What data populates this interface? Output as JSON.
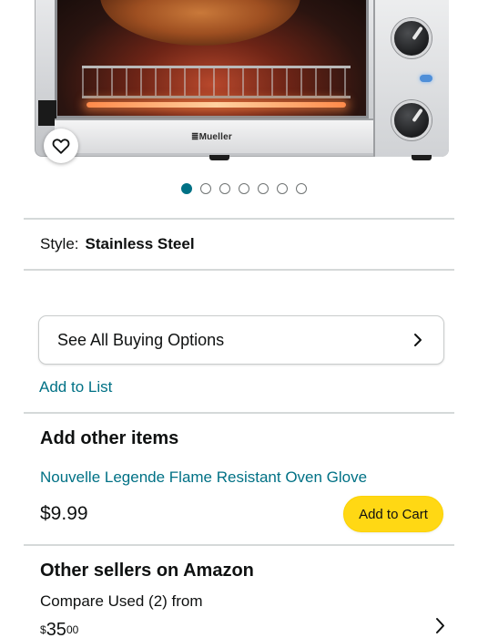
{
  "product_image": {
    "brand_logo": "≣Mueller",
    "wishlist_icon": "heart-outline-icon"
  },
  "carousel": {
    "total_images": 7,
    "active_index": 0,
    "active_color": "#007185"
  },
  "style": {
    "label": "Style:",
    "value": "Stainless Steel"
  },
  "buying_options": {
    "label": "See All Buying Options",
    "icon": "chevron-right-icon"
  },
  "add_to_list": {
    "label": "Add to List"
  },
  "add_other_items": {
    "title": "Add other items",
    "item_name": "Nouvelle Legende Flame Resistant Oven Glove",
    "item_price": "$9.99",
    "add_to_cart_label": "Add to Cart",
    "add_to_cart_color": "#ffd814"
  },
  "other_sellers": {
    "title": "Other sellers on Amazon",
    "compare_text": "Compare Used (2) from",
    "price_symbol": "$",
    "price_whole": "35",
    "price_fraction": "00",
    "icon": "chevron-right-icon"
  },
  "colors": {
    "link": "#007185",
    "text": "#0f1111",
    "divider": "#d5d9d9"
  }
}
